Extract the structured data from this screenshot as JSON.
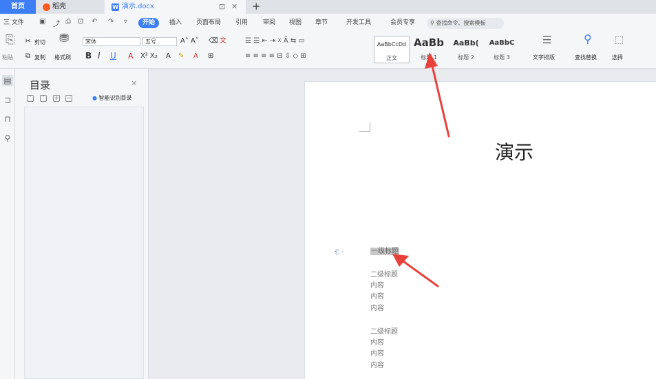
{
  "tabs": {
    "home": "首页",
    "wps": "稻壳",
    "doc": "演示.docx",
    "new_tab": "+"
  },
  "menu": {
    "items": [
      "三 文件",
      "插入",
      "页面布局",
      "引用",
      "审阅",
      "视图",
      "章节",
      "开发工具",
      "会员专享"
    ],
    "active": "开始",
    "search_placeholder": "查找命令、搜索模板"
  },
  "ribbon": {
    "paste": "粘贴",
    "cut": "剪切",
    "copy": "复制",
    "format_painter": "格式刷",
    "font_name": "宋体",
    "font_size": "五号",
    "bold": "B",
    "italic": "I",
    "underline": "U",
    "text_layout": "文字排版",
    "find_replace": "查找替换",
    "select": "选择"
  },
  "styles": [
    {
      "sample": "AaBbCcDd",
      "name": "正文"
    },
    {
      "sample": "AaBb",
      "name": "标题 1"
    },
    {
      "sample": "AaBb(",
      "name": "标题 2"
    },
    {
      "sample": "AaBbC",
      "name": "标题 3"
    }
  ],
  "toc": {
    "title": "目录",
    "close": "×",
    "smart_toc": "智能识别目录"
  },
  "document": {
    "title": "演示",
    "lines": [
      "一级标题",
      "二级标题",
      "内容",
      "内容",
      "内容",
      "二级标题",
      "内容",
      "内容",
      "内容"
    ]
  },
  "colors": {
    "accent": "#3d7ef6",
    "arrow": "#e8413c"
  }
}
